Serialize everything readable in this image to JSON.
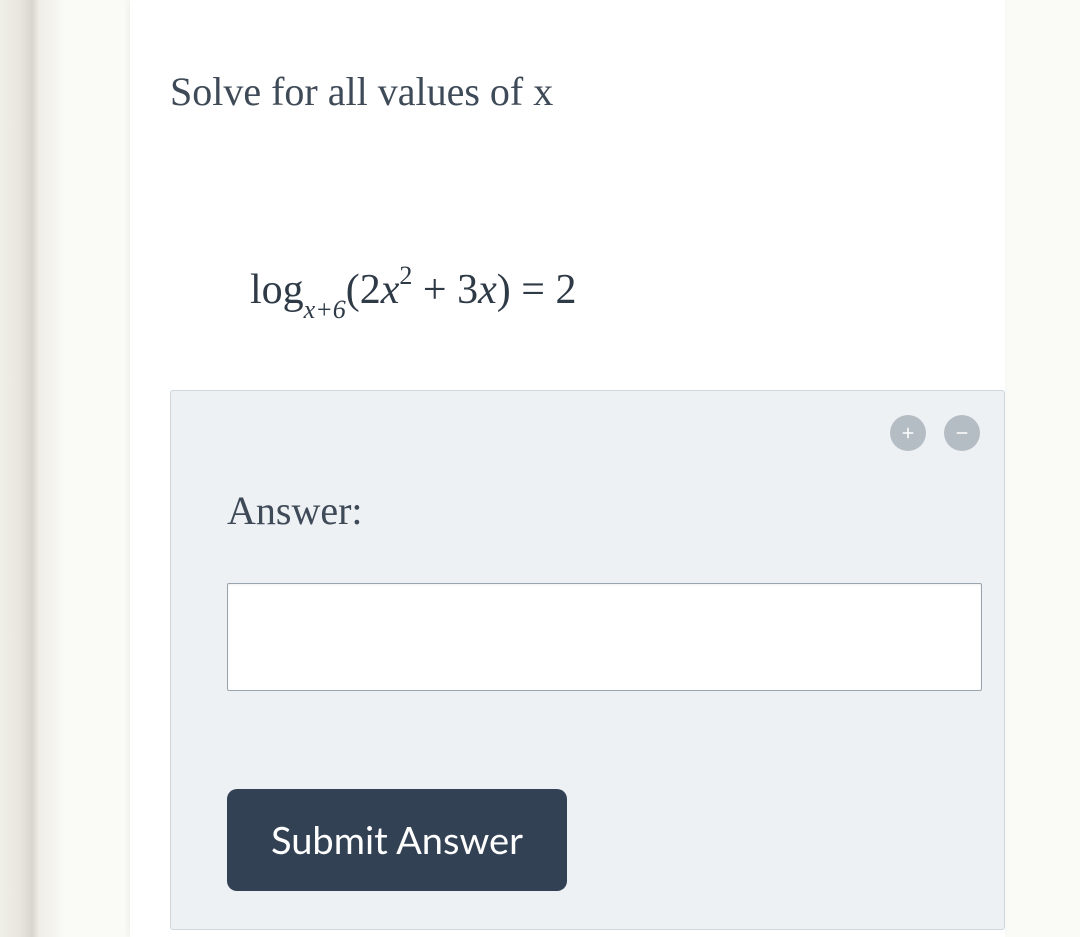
{
  "question": {
    "prompt": "Solve for all values of x",
    "equation": {
      "base": "x+6",
      "argument": "2x² + 3x",
      "rhs": "2"
    }
  },
  "answer_box": {
    "label": "Answer:",
    "input_value": "",
    "submit_label": "Submit Answer"
  },
  "controls": {
    "zoom_in": "plus-icon",
    "zoom_out": "minus-icon"
  }
}
